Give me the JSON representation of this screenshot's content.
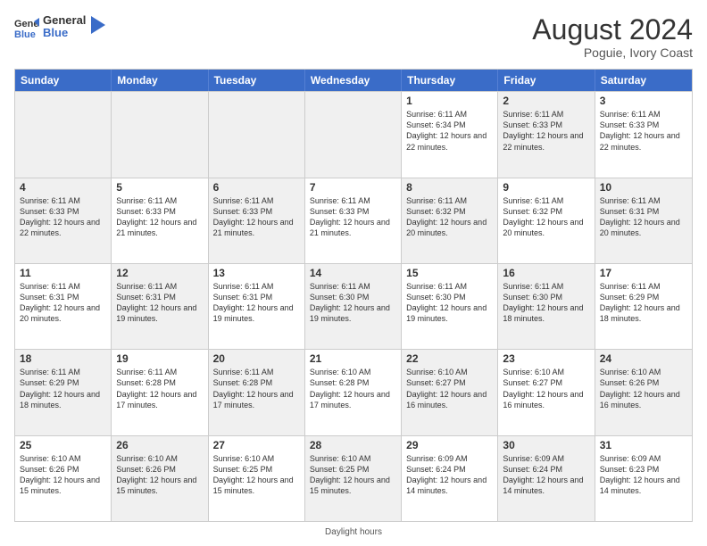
{
  "header": {
    "logo_line1": "General",
    "logo_line2": "Blue",
    "month": "August 2024",
    "location": "Poguie, Ivory Coast"
  },
  "days_of_week": [
    "Sunday",
    "Monday",
    "Tuesday",
    "Wednesday",
    "Thursday",
    "Friday",
    "Saturday"
  ],
  "weeks": [
    [
      {
        "day": "",
        "info": "",
        "shaded": true
      },
      {
        "day": "",
        "info": "",
        "shaded": true
      },
      {
        "day": "",
        "info": "",
        "shaded": true
      },
      {
        "day": "",
        "info": "",
        "shaded": true
      },
      {
        "day": "1",
        "info": "Sunrise: 6:11 AM\nSunset: 6:34 PM\nDaylight: 12 hours\nand 22 minutes.",
        "shaded": false
      },
      {
        "day": "2",
        "info": "Sunrise: 6:11 AM\nSunset: 6:33 PM\nDaylight: 12 hours\nand 22 minutes.",
        "shaded": true
      },
      {
        "day": "3",
        "info": "Sunrise: 6:11 AM\nSunset: 6:33 PM\nDaylight: 12 hours\nand 22 minutes.",
        "shaded": false
      }
    ],
    [
      {
        "day": "4",
        "info": "Sunrise: 6:11 AM\nSunset: 6:33 PM\nDaylight: 12 hours\nand 22 minutes.",
        "shaded": true
      },
      {
        "day": "5",
        "info": "Sunrise: 6:11 AM\nSunset: 6:33 PM\nDaylight: 12 hours\nand 21 minutes.",
        "shaded": false
      },
      {
        "day": "6",
        "info": "Sunrise: 6:11 AM\nSunset: 6:33 PM\nDaylight: 12 hours\nand 21 minutes.",
        "shaded": true
      },
      {
        "day": "7",
        "info": "Sunrise: 6:11 AM\nSunset: 6:33 PM\nDaylight: 12 hours\nand 21 minutes.",
        "shaded": false
      },
      {
        "day": "8",
        "info": "Sunrise: 6:11 AM\nSunset: 6:32 PM\nDaylight: 12 hours\nand 20 minutes.",
        "shaded": true
      },
      {
        "day": "9",
        "info": "Sunrise: 6:11 AM\nSunset: 6:32 PM\nDaylight: 12 hours\nand 20 minutes.",
        "shaded": false
      },
      {
        "day": "10",
        "info": "Sunrise: 6:11 AM\nSunset: 6:31 PM\nDaylight: 12 hours\nand 20 minutes.",
        "shaded": true
      }
    ],
    [
      {
        "day": "11",
        "info": "Sunrise: 6:11 AM\nSunset: 6:31 PM\nDaylight: 12 hours\nand 20 minutes.",
        "shaded": false
      },
      {
        "day": "12",
        "info": "Sunrise: 6:11 AM\nSunset: 6:31 PM\nDaylight: 12 hours\nand 19 minutes.",
        "shaded": true
      },
      {
        "day": "13",
        "info": "Sunrise: 6:11 AM\nSunset: 6:31 PM\nDaylight: 12 hours\nand 19 minutes.",
        "shaded": false
      },
      {
        "day": "14",
        "info": "Sunrise: 6:11 AM\nSunset: 6:30 PM\nDaylight: 12 hours\nand 19 minutes.",
        "shaded": true
      },
      {
        "day": "15",
        "info": "Sunrise: 6:11 AM\nSunset: 6:30 PM\nDaylight: 12 hours\nand 19 minutes.",
        "shaded": false
      },
      {
        "day": "16",
        "info": "Sunrise: 6:11 AM\nSunset: 6:30 PM\nDaylight: 12 hours\nand 18 minutes.",
        "shaded": true
      },
      {
        "day": "17",
        "info": "Sunrise: 6:11 AM\nSunset: 6:29 PM\nDaylight: 12 hours\nand 18 minutes.",
        "shaded": false
      }
    ],
    [
      {
        "day": "18",
        "info": "Sunrise: 6:11 AM\nSunset: 6:29 PM\nDaylight: 12 hours\nand 18 minutes.",
        "shaded": true
      },
      {
        "day": "19",
        "info": "Sunrise: 6:11 AM\nSunset: 6:28 PM\nDaylight: 12 hours\nand 17 minutes.",
        "shaded": false
      },
      {
        "day": "20",
        "info": "Sunrise: 6:11 AM\nSunset: 6:28 PM\nDaylight: 12 hours\nand 17 minutes.",
        "shaded": true
      },
      {
        "day": "21",
        "info": "Sunrise: 6:10 AM\nSunset: 6:28 PM\nDaylight: 12 hours\nand 17 minutes.",
        "shaded": false
      },
      {
        "day": "22",
        "info": "Sunrise: 6:10 AM\nSunset: 6:27 PM\nDaylight: 12 hours\nand 16 minutes.",
        "shaded": true
      },
      {
        "day": "23",
        "info": "Sunrise: 6:10 AM\nSunset: 6:27 PM\nDaylight: 12 hours\nand 16 minutes.",
        "shaded": false
      },
      {
        "day": "24",
        "info": "Sunrise: 6:10 AM\nSunset: 6:26 PM\nDaylight: 12 hours\nand 16 minutes.",
        "shaded": true
      }
    ],
    [
      {
        "day": "25",
        "info": "Sunrise: 6:10 AM\nSunset: 6:26 PM\nDaylight: 12 hours\nand 15 minutes.",
        "shaded": false
      },
      {
        "day": "26",
        "info": "Sunrise: 6:10 AM\nSunset: 6:26 PM\nDaylight: 12 hours\nand 15 minutes.",
        "shaded": true
      },
      {
        "day": "27",
        "info": "Sunrise: 6:10 AM\nSunset: 6:25 PM\nDaylight: 12 hours\nand 15 minutes.",
        "shaded": false
      },
      {
        "day": "28",
        "info": "Sunrise: 6:10 AM\nSunset: 6:25 PM\nDaylight: 12 hours\nand 15 minutes.",
        "shaded": true
      },
      {
        "day": "29",
        "info": "Sunrise: 6:09 AM\nSunset: 6:24 PM\nDaylight: 12 hours\nand 14 minutes.",
        "shaded": false
      },
      {
        "day": "30",
        "info": "Sunrise: 6:09 AM\nSunset: 6:24 PM\nDaylight: 12 hours\nand 14 minutes.",
        "shaded": true
      },
      {
        "day": "31",
        "info": "Sunrise: 6:09 AM\nSunset: 6:23 PM\nDaylight: 12 hours\nand 14 minutes.",
        "shaded": false
      }
    ]
  ],
  "footer": "Daylight hours"
}
